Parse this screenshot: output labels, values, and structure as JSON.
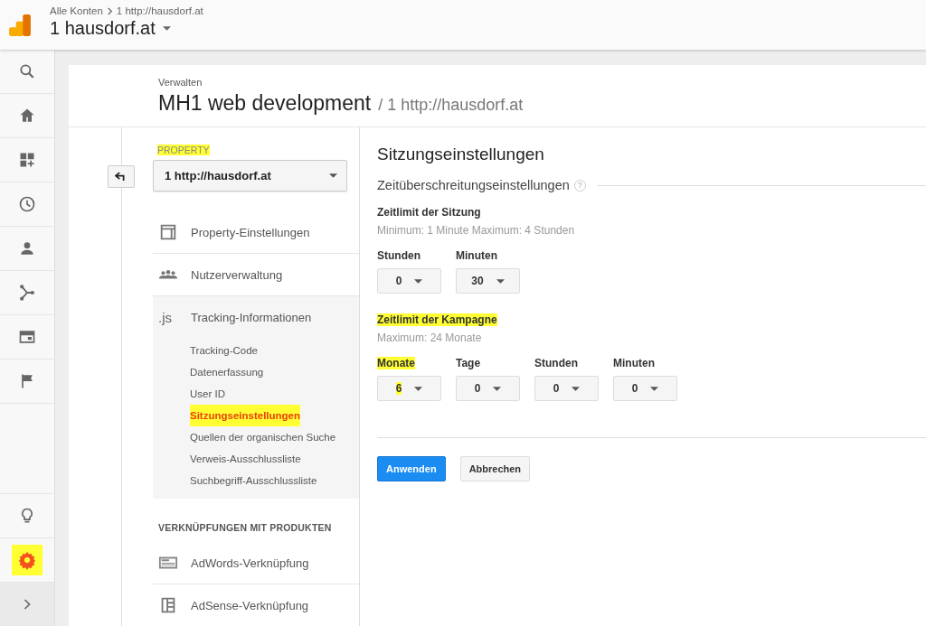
{
  "header": {
    "breadcrumb": [
      "Alle Konten",
      "1 http://hausdorf.at"
    ],
    "account": "1 hausdorf.at"
  },
  "rail": {
    "settings": {
      "selected": true,
      "highlighted": true
    }
  },
  "page": {
    "overline": "Verwalten",
    "title": "MH1 web development",
    "subtitle": "/ 1 http://hausdorf.at"
  },
  "property": {
    "label": "PROPERTY",
    "label_highlighted": true,
    "select": "1 http://hausdorf.at",
    "items": [
      {
        "label": "Property-Einstellungen",
        "expanded": false
      },
      {
        "label": "Nutzerverwaltung",
        "expanded": false
      },
      {
        "badge": ".js",
        "label": "Tracking-Informationen",
        "expanded": true,
        "children": [
          {
            "label": "Tracking-Code",
            "selected": false,
            "highlighted": false
          },
          {
            "label": "Datenerfassung",
            "selected": false,
            "highlighted": false
          },
          {
            "label": "User ID",
            "selected": false,
            "highlighted": false
          },
          {
            "label": "Sitzungseinstellungen",
            "selected": true,
            "highlighted": true
          },
          {
            "label": "Quellen der organischen Suche",
            "selected": false,
            "highlighted": false
          },
          {
            "label": "Verweis-Ausschlussliste",
            "selected": false,
            "highlighted": false
          },
          {
            "label": "Suchbegriff-Ausschlussliste",
            "selected": false,
            "highlighted": false
          }
        ]
      }
    ],
    "links_heading": "VERKNÜPFUNGEN MIT PRODUKTEN",
    "links": [
      "AdWords-Verknüpfung",
      "AdSense-Verknüpfung"
    ]
  },
  "settings": {
    "title": "Sitzungseinstellungen",
    "section": "Zeitüberschreitungseinstellungen",
    "help": "?",
    "groups": [
      {
        "title": "Zeitlimit der Sitzung",
        "highlighted": false,
        "hint": "Minimum: 1 Minute Maximum: 4 Stunden",
        "fields": [
          {
            "label": "Stunden",
            "value": "0",
            "highlighted": false
          },
          {
            "label": "Minuten",
            "value": "30",
            "highlighted": false
          }
        ]
      },
      {
        "title": "Zeitlimit der Kampagne",
        "highlighted": true,
        "hint": "Maximum: 24 Monate",
        "fields": [
          {
            "label": "Monate",
            "value": "6",
            "highlighted": true
          },
          {
            "label": "Tage",
            "value": "0",
            "highlighted": false
          },
          {
            "label": "Stunden",
            "value": "0",
            "highlighted": false
          },
          {
            "label": "Minuten",
            "value": "0",
            "highlighted": false
          }
        ]
      }
    ],
    "buttons": [
      {
        "label": "Anwenden",
        "kind": "primary"
      },
      {
        "label": "Abbrechen",
        "kind": "secondary"
      }
    ]
  }
}
